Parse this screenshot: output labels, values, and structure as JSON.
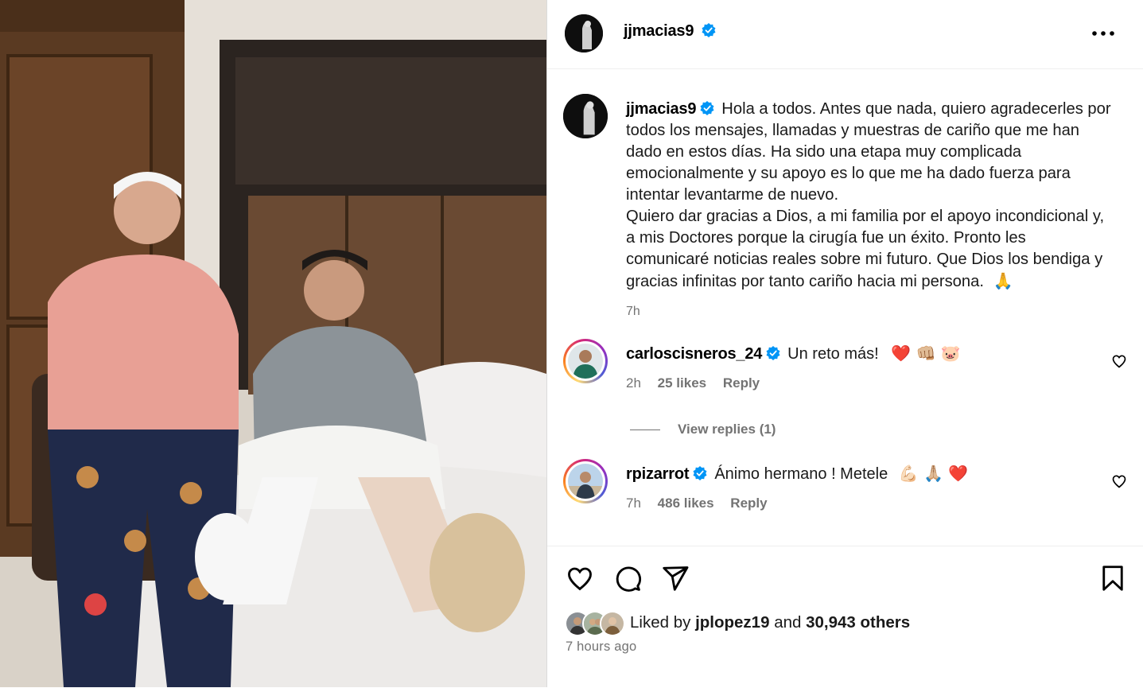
{
  "post": {
    "author": "jjmacias9",
    "caption_author": "jjmacias9",
    "caption_line1": "Hola a todos. Antes que nada, quiero agradecerles por",
    "caption_line2": "todos los mensajes, llamadas y muestras de cariño que me han",
    "caption_line3": "dado en estos días. Ha sido una etapa muy complicada",
    "caption_line4": "emocionalmente y su apoyo es lo que me ha dado fuerza para",
    "caption_line5": "intentar levantarme de nuevo.",
    "caption_line6": "Quiero dar gracias a Dios, a mi familia por el apoyo incondicional y,",
    "caption_line7": "a mis Doctores porque la cirugía fue un éxito. Pronto les",
    "caption_line8": "comunicaré noticias reales sobre mi futuro. Que Dios los bendiga y",
    "caption_line9": "gracias infinitas por tanto cariño hacia mi persona.",
    "caption_emoji": "🙏",
    "caption_time": "7h"
  },
  "comments": [
    {
      "user": "carloscisneros_24",
      "text": "Un reto más!",
      "emoji": "❤️ 👊🏼 🐷",
      "time": "2h",
      "likes": "25 likes",
      "reply_label": "Reply",
      "view_replies": "View replies (1)"
    },
    {
      "user": "rpizarrot",
      "text": "Ánimo hermano ! Metele",
      "emoji": "💪🏻 🙏🏼 ❤️",
      "time": "7h",
      "likes": "486 likes",
      "reply_label": "Reply"
    }
  ],
  "footer": {
    "liked_prefix": "Liked by",
    "liked_user": "jplopez19",
    "liked_and": "and",
    "liked_count": "30,943 others",
    "posted_time": "7 hours ago"
  },
  "colors": {
    "verified": "#0095f6",
    "muted": "#737373",
    "border": "#dbdbdb",
    "heart_red": "#ff3040"
  }
}
